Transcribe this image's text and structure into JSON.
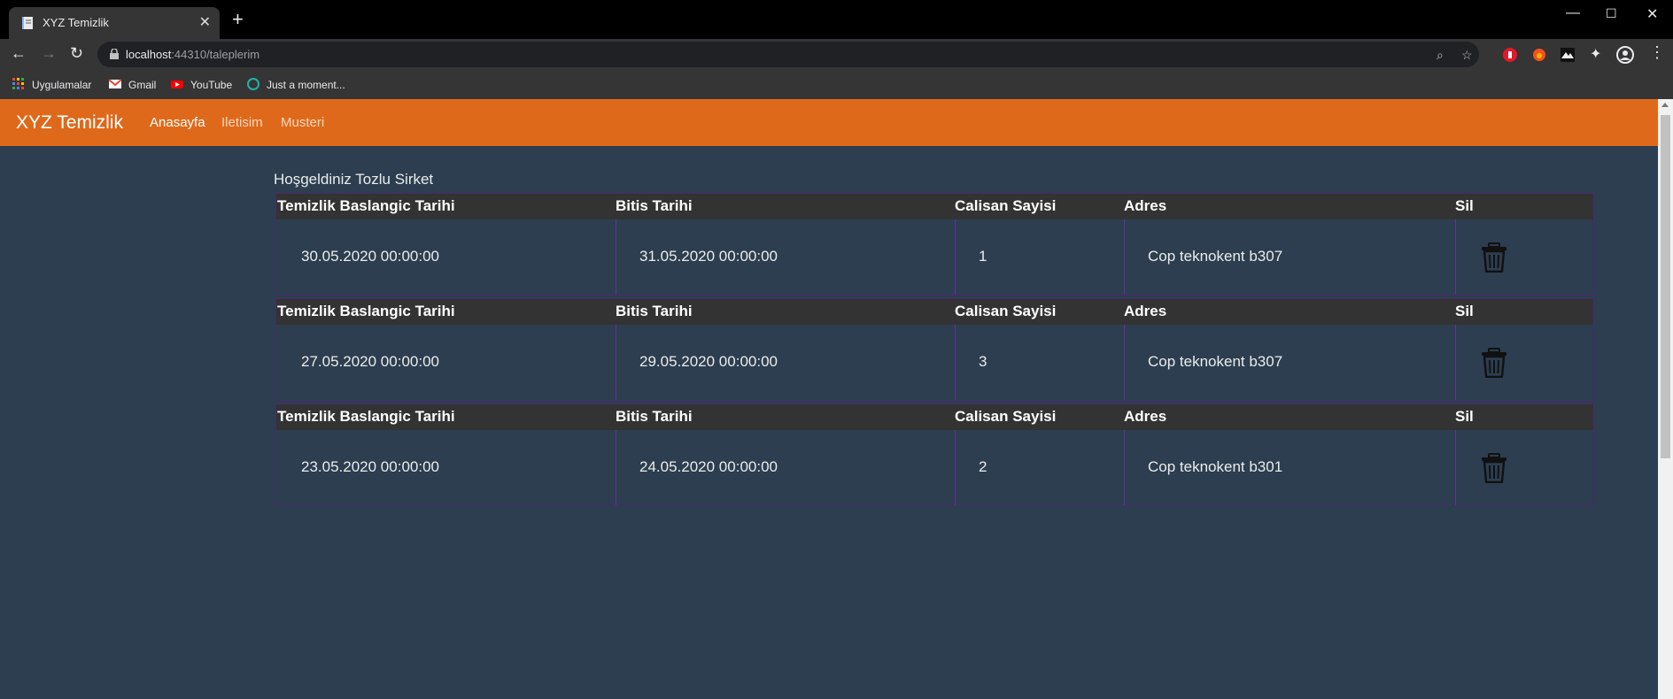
{
  "browser": {
    "tab_title": "XYZ Temizlik",
    "new_tab": "+",
    "url_host": "localhost",
    "url_rest": ":44310/taleplerim",
    "bookmarks": [
      "Uygulamalar",
      "Gmail",
      "YouTube",
      "Just a moment..."
    ]
  },
  "navbar": {
    "brand": "XYZ Temizlik",
    "links": [
      "Anasayfa",
      "Iletisim",
      "Musteri"
    ]
  },
  "welcome": "Hoşgeldiniz Tozlu Sirket",
  "table": {
    "headers": [
      "Temizlik Baslangic Tarihi",
      "Bitis Tarihi",
      "Calisan Sayisi",
      "Adres",
      "Sil"
    ],
    "rows": [
      {
        "start": "30.05.2020 00:00:00",
        "end": "31.05.2020 00:00:00",
        "count": "1",
        "address": "Cop teknokent b307"
      },
      {
        "start": "27.05.2020 00:00:00",
        "end": "29.05.2020 00:00:00",
        "count": "3",
        "address": "Cop teknokent b307"
      },
      {
        "start": "23.05.2020 00:00:00",
        "end": "24.05.2020 00:00:00",
        "count": "2",
        "address": "Cop teknokent b301"
      }
    ]
  },
  "colors": {
    "navbar": "#df691a",
    "background": "#2c3e50",
    "header_row": "#333333",
    "cell_border": "#6a2ca0"
  },
  "icons": {
    "delete": "trash-icon"
  }
}
